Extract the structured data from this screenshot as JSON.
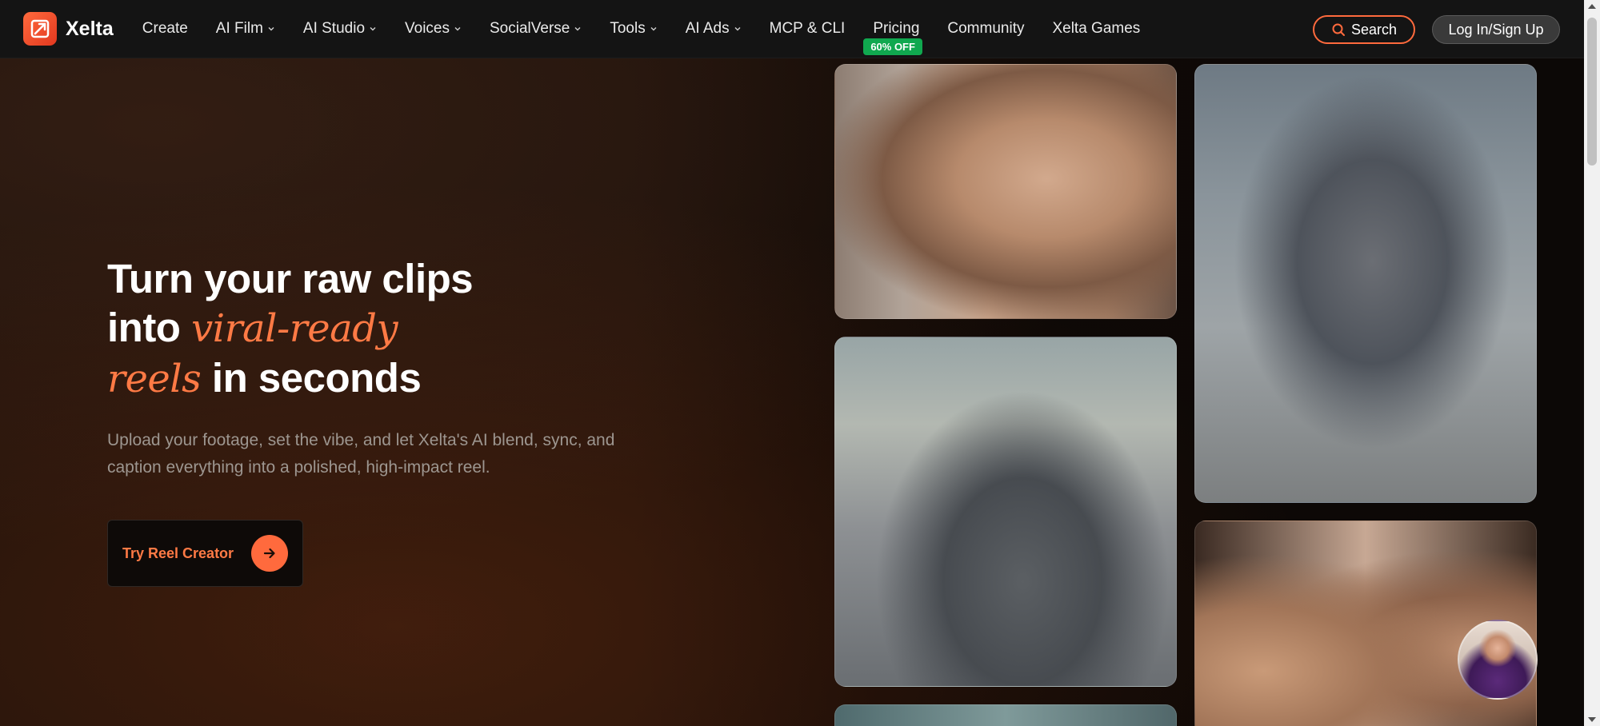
{
  "brand": {
    "name": "Xelta"
  },
  "nav": {
    "items": [
      {
        "label": "Create",
        "has_dropdown": false
      },
      {
        "label": "AI Film",
        "has_dropdown": true
      },
      {
        "label": "AI Studio",
        "has_dropdown": true
      },
      {
        "label": "Voices",
        "has_dropdown": true
      },
      {
        "label": "SocialVerse",
        "has_dropdown": true
      },
      {
        "label": "Tools",
        "has_dropdown": true
      },
      {
        "label": "AI Ads",
        "has_dropdown": true
      },
      {
        "label": "MCP & CLI",
        "has_dropdown": false
      },
      {
        "label": "Pricing",
        "has_dropdown": false,
        "badge": "60% OFF"
      },
      {
        "label": "Community",
        "has_dropdown": false
      },
      {
        "label": "Xelta Games",
        "has_dropdown": false
      }
    ],
    "search_label": "Search",
    "login_label": "Log In/Sign Up"
  },
  "hero": {
    "line1": "Turn your raw clips",
    "line2_prefix": "into ",
    "line2_accent": "viral-ready",
    "line3_accent": "reels",
    "line3_suffix": " in seconds",
    "subtitle": "Upload your footage, set the vibe, and let Xelta's AI blend, sync, and caption everything into a polished, high-impact reel.",
    "cta_label": "Try Reel Creator"
  },
  "colors": {
    "accent": "#ff6a3d",
    "accent_text": "#ff7a45",
    "badge": "#10a84f",
    "nav_bg": "#141414"
  }
}
